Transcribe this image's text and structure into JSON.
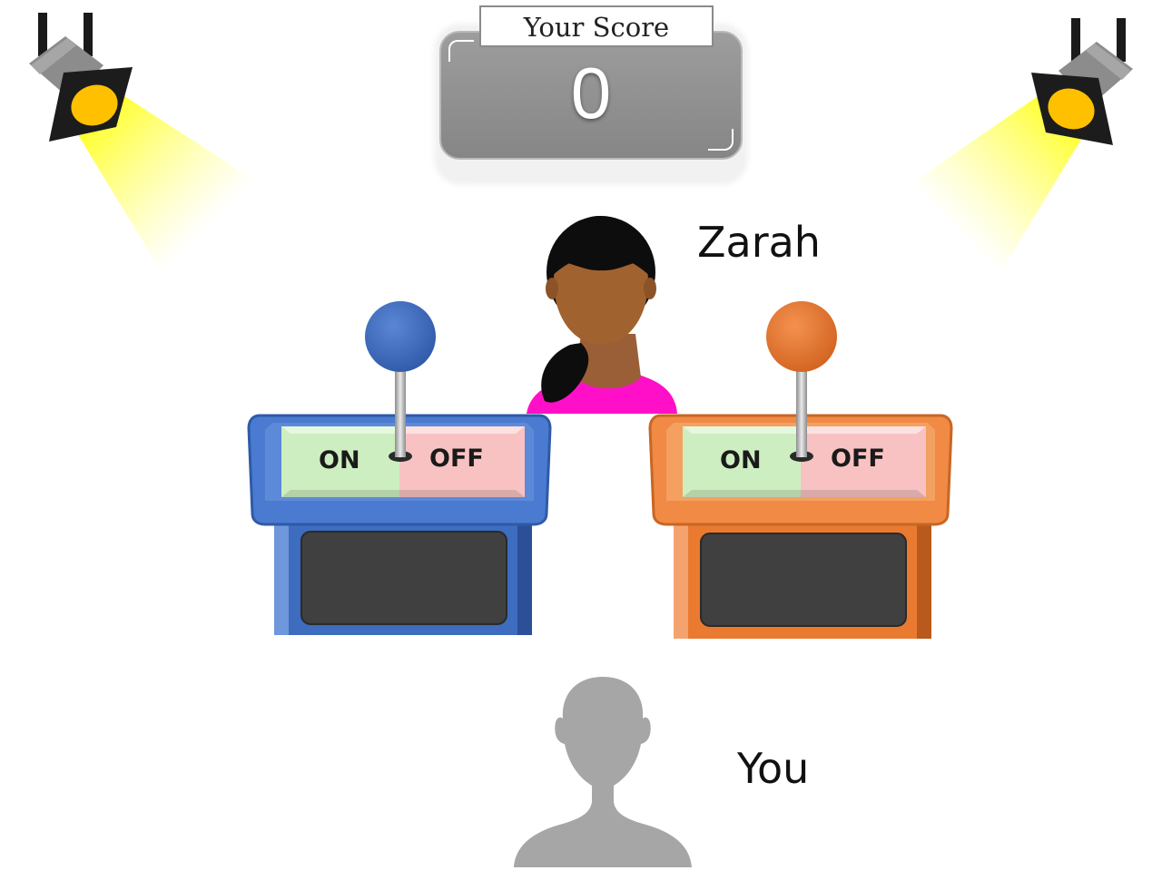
{
  "score": {
    "label": "Your Score",
    "value": "0"
  },
  "opponent": {
    "name": "Zarah",
    "avatar": "woman-avatar"
  },
  "player": {
    "name": "You",
    "avatar": "person-silhouette"
  },
  "switches": [
    {
      "id": "blue",
      "on_label": "ON",
      "off_label": "OFF",
      "color": "#4472c4",
      "knob_color": "#3f6bbf"
    },
    {
      "id": "orange",
      "on_label": "ON",
      "off_label": "OFF",
      "color": "#ed7d31",
      "knob_color": "#e8772f"
    }
  ],
  "colors": {
    "spotlight_beam": "#ffff33",
    "spotlight_lens": "#ffc000",
    "on_panel": "#cdeec0",
    "off_panel": "#f8c2c2",
    "screen": "#404040"
  },
  "icons": [
    "spotlight-icon",
    "woman-avatar-icon",
    "person-silhouette-icon"
  ]
}
